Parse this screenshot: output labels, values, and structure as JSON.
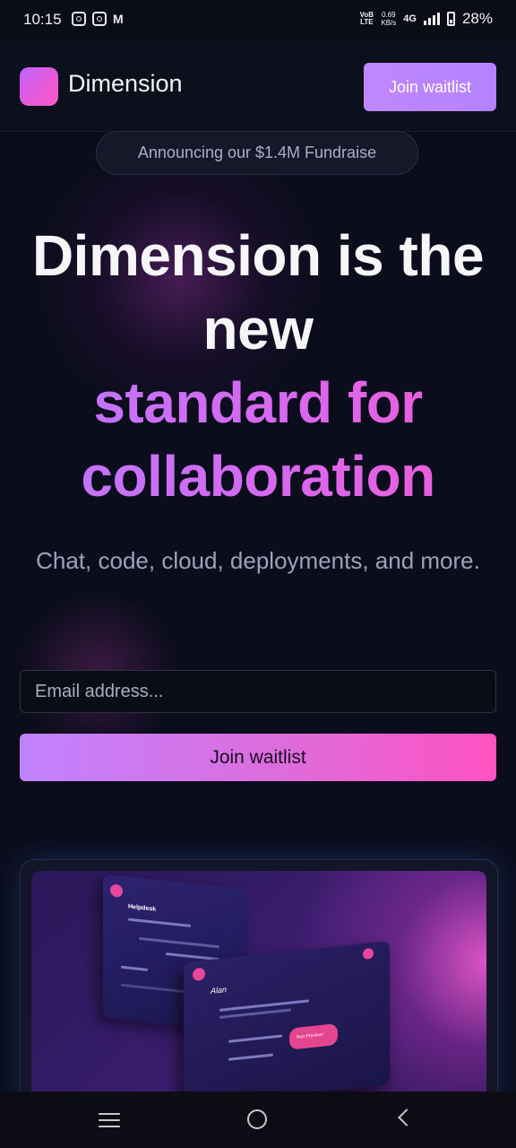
{
  "status_bar": {
    "time": "10:15",
    "volte": "VoB LTE",
    "speed_value": "0.69",
    "speed_unit": "KB/s",
    "network": "4G",
    "battery": "28%"
  },
  "nav": {
    "brand": "Dimension",
    "cta_label": "Join waitlist"
  },
  "announcement": "Announcing our $1.4M Fundraise",
  "hero": {
    "line1": "Dimension is the",
    "line2": "new",
    "line3": "standard for",
    "line4": "collaboration",
    "subtitle": "Chat, code, cloud, deployments, and more."
  },
  "form": {
    "email_placeholder": "Email address...",
    "email_value": "",
    "submit_label": "Join waitlist"
  },
  "preview": {
    "screen1_title": "Helpdesk",
    "screen2_name": "Alan",
    "bubble_text": "Run Preview!"
  },
  "colors": {
    "background": "#0b0d1c",
    "accent_purple": "#c087ff",
    "accent_pink": "#ff52c2"
  }
}
